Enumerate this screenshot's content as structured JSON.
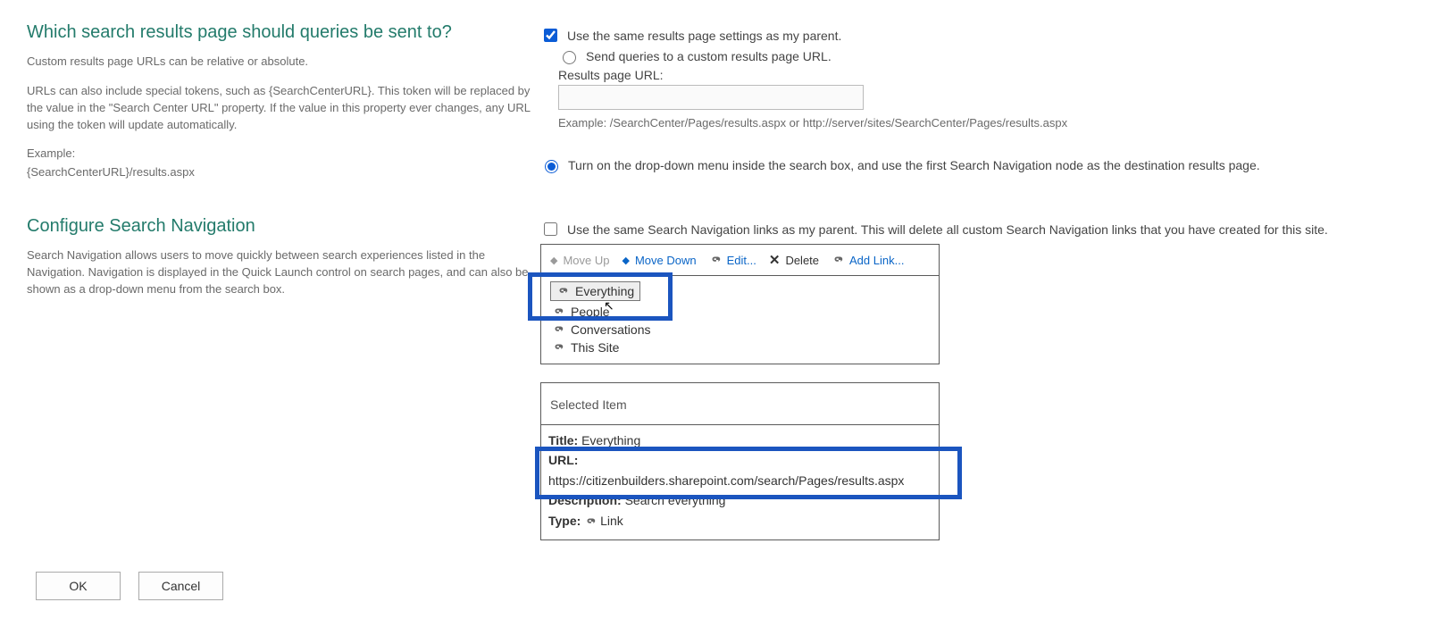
{
  "section1": {
    "title": "Which search results page should queries be sent to?",
    "help1": "Custom results page URLs can be relative or absolute.",
    "help2": "URLs can also include special tokens, such as {SearchCenterURL}. This token will be replaced by the value in the \"Search Center URL\" property. If the value in this property ever changes, any URL using the token will update automatically.",
    "help3a": "Example:",
    "help3b": "{SearchCenterURL}/results.aspx",
    "opt_parent": "Use the same results page settings as my parent.",
    "opt_custom": "Send queries to a custom results page URL.",
    "results_label": "Results page URL:",
    "example": "Example: /SearchCenter/Pages/results.aspx or http://server/sites/SearchCenter/Pages/results.aspx",
    "opt_dropdown": "Turn on the drop-down menu inside the search box, and use the first Search Navigation node as the destination results page."
  },
  "section2": {
    "title": "Configure Search Navigation",
    "help": "Search Navigation allows users to move quickly between search experiences listed in the Navigation. Navigation is displayed in the Quick Launch control on search pages, and can also be shown as a drop-down menu from the search box.",
    "cb_parent": "Use the same Search Navigation links as my parent. This will delete all custom Search Navigation links that you have created for this site."
  },
  "toolbar": {
    "move_up": "Move Up",
    "move_down": "Move Down",
    "edit": "Edit...",
    "delete": "Delete",
    "add_link": "Add Link..."
  },
  "nav_items": [
    "Everything",
    "People",
    "Conversations",
    "This Site"
  ],
  "selected": {
    "panel_label": "Selected Item",
    "title_label": "Title:",
    "title": "Everything",
    "url_label": "URL:",
    "url": "https://citizenbuilders.sharepoint.com/search/Pages/results.aspx",
    "desc_label": "Description:",
    "desc": "Search everything",
    "type_label": "Type:",
    "type": "Link"
  },
  "buttons": {
    "ok": "OK",
    "cancel": "Cancel"
  }
}
